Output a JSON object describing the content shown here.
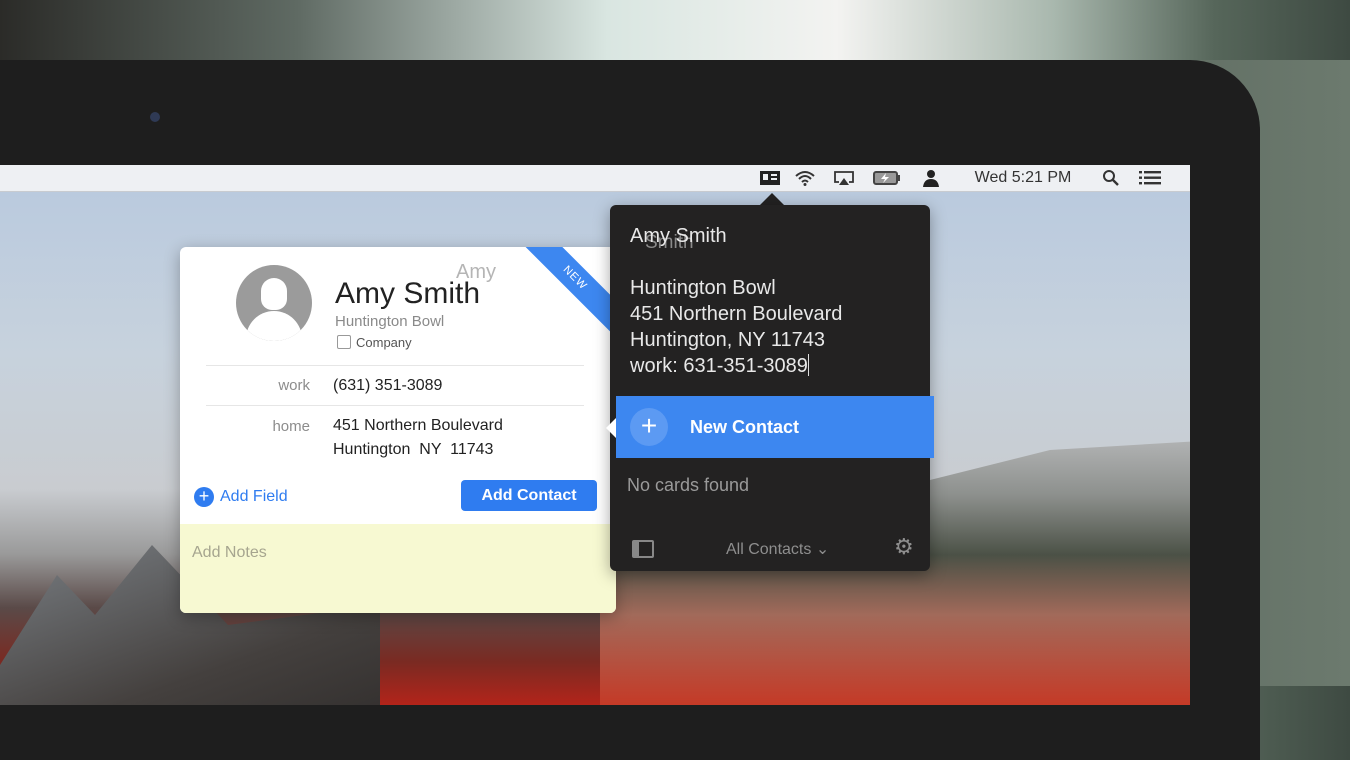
{
  "menubar": {
    "clock": "Wed 5:21 PM",
    "icons": [
      "contacts-card-icon",
      "wifi-icon",
      "airplay-icon",
      "battery-charging-icon",
      "user-icon",
      "search-icon",
      "notification-list-icon"
    ]
  },
  "contact_card": {
    "badge": "NEW",
    "ghost_first_name": "Amy",
    "name": "Amy Smith",
    "company": "Huntington Bowl",
    "company_checkbox_label": "Company",
    "company_checked": false,
    "fields": [
      {
        "label": "work",
        "lines": [
          "(631) 351-3089"
        ]
      },
      {
        "label": "home",
        "lines": [
          "451 Northern Boulevard",
          "Huntington  NY  11743"
        ]
      }
    ],
    "add_field_label": "Add Field",
    "add_contact_label": "Add Contact",
    "notes_placeholder": "Add Notes"
  },
  "popover": {
    "input_lines": [
      "Amy Smith",
      "",
      "Huntington Bowl",
      "451 Northern Boulevard",
      "Huntington, NY 11743",
      "work: 631-351-3089"
    ],
    "ghost_text": "Smith",
    "new_contact_label": "New Contact",
    "empty_state": "No cards found",
    "group_selector": "All Contacts ⌄",
    "accent_color": "#3d87f0"
  }
}
